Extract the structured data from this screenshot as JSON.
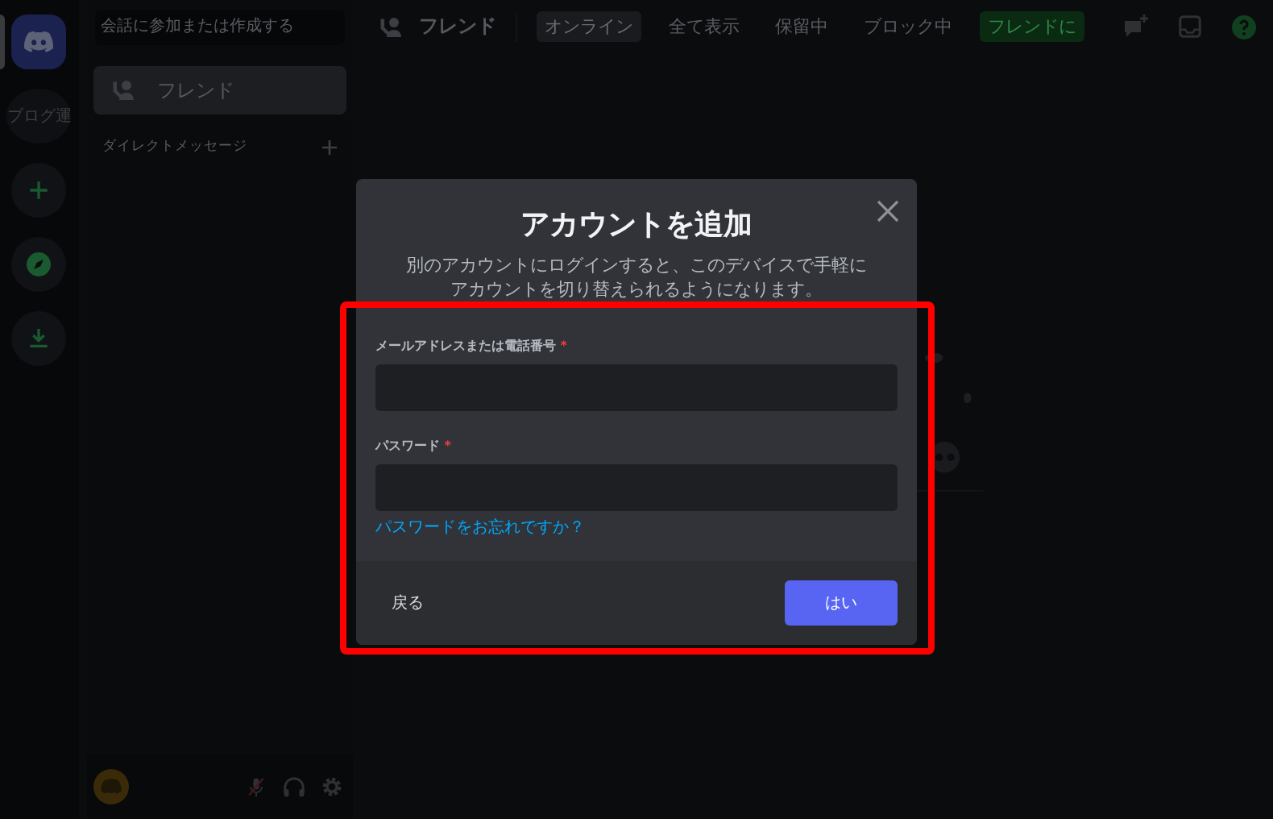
{
  "server_rail": {
    "servers": [
      {
        "kind": "home",
        "selected": true
      },
      {
        "kind": "text",
        "label": "ブログ運"
      },
      {
        "kind": "add"
      },
      {
        "kind": "explore"
      },
      {
        "kind": "download"
      }
    ]
  },
  "sidebar": {
    "search": {
      "placeholder": "会話に参加または作成する"
    },
    "items": [
      {
        "label": "フレンド",
        "selected": true
      }
    ],
    "section_title": "ダイレクトメッセージ"
  },
  "top_bar": {
    "title": "フレンド",
    "tabs": [
      {
        "label": "オンライン",
        "selected": true,
        "kind": "tab"
      },
      {
        "label": "全て表示",
        "selected": false,
        "kind": "tab"
      },
      {
        "label": "保留中",
        "selected": false,
        "kind": "tab"
      },
      {
        "label": "ブロック中",
        "selected": false,
        "kind": "tab"
      },
      {
        "label": "フレンドに",
        "kind": "add"
      }
    ]
  },
  "dialog": {
    "title": "アカウントを追加",
    "description": "別のアカウントにログインすると、このデバイスで手軽にアカウントを切り替えられるようになります。",
    "fields": [
      {
        "label": "メールアドレスまたは電話番号",
        "required_mark": "*"
      },
      {
        "label": "パスワード",
        "required_mark": "*"
      }
    ],
    "forgot_link": "パスワードをお忘れですか？",
    "back_button": "戻る",
    "confirm_button": "はい",
    "highlighted": true
  }
}
